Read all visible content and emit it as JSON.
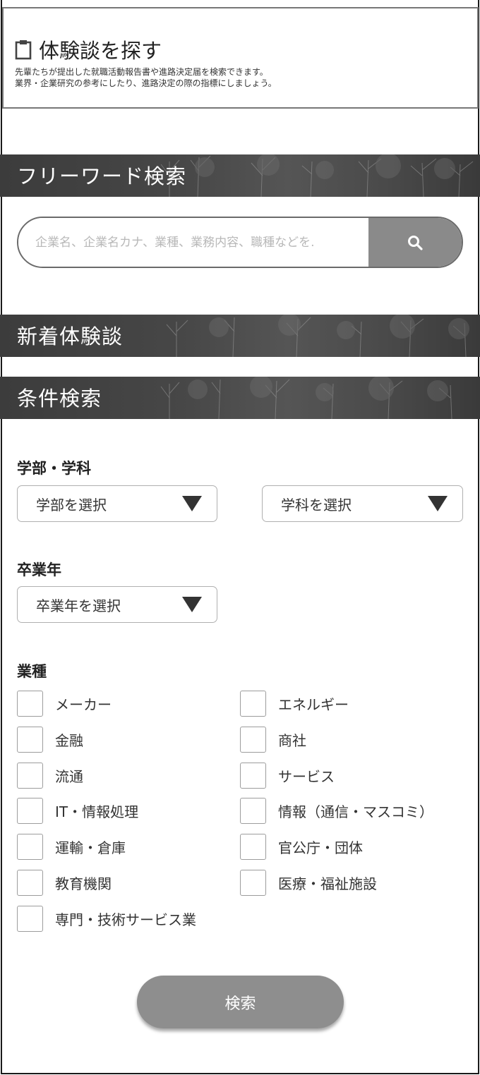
{
  "header": {
    "title": "体験談を探す",
    "title_icon": "clipboard-icon",
    "description_line1": "先輩たちが提出した就職活動報告書や進路決定届を検索できます。",
    "description_line2": "業界・企業研究の参考にしたり、進路決定の際の指標にしましょう。"
  },
  "sections": {
    "free_word": "フリーワード検索",
    "new_stories": "新着体験談",
    "condition_search": "条件検索"
  },
  "search": {
    "placeholder": "企業名、企業名カナ、業種、業務内容、職種などを.",
    "button_icon": "search-icon"
  },
  "filters": {
    "faculty_label": "学部・学科",
    "faculty_select": "学部を選択",
    "department_select": "学科を選択",
    "grad_year_label": "卒業年",
    "grad_year_select": "卒業年を選択",
    "industry_label": "業種"
  },
  "industries": [
    "メーカー",
    "エネルギー",
    "金融",
    "商社",
    "流通",
    "サービス",
    "IT・情報処理",
    "情報（通信・マスコミ）",
    "運輸・倉庫",
    "官公庁・団体",
    "教育機関",
    "医療・福祉施設",
    "専門・技術サービス業"
  ],
  "submit_label": "検索",
  "colors": {
    "section_bar": "#444444",
    "search_button": "#8a8a8a",
    "submit_button": "#8e8e8e"
  }
}
